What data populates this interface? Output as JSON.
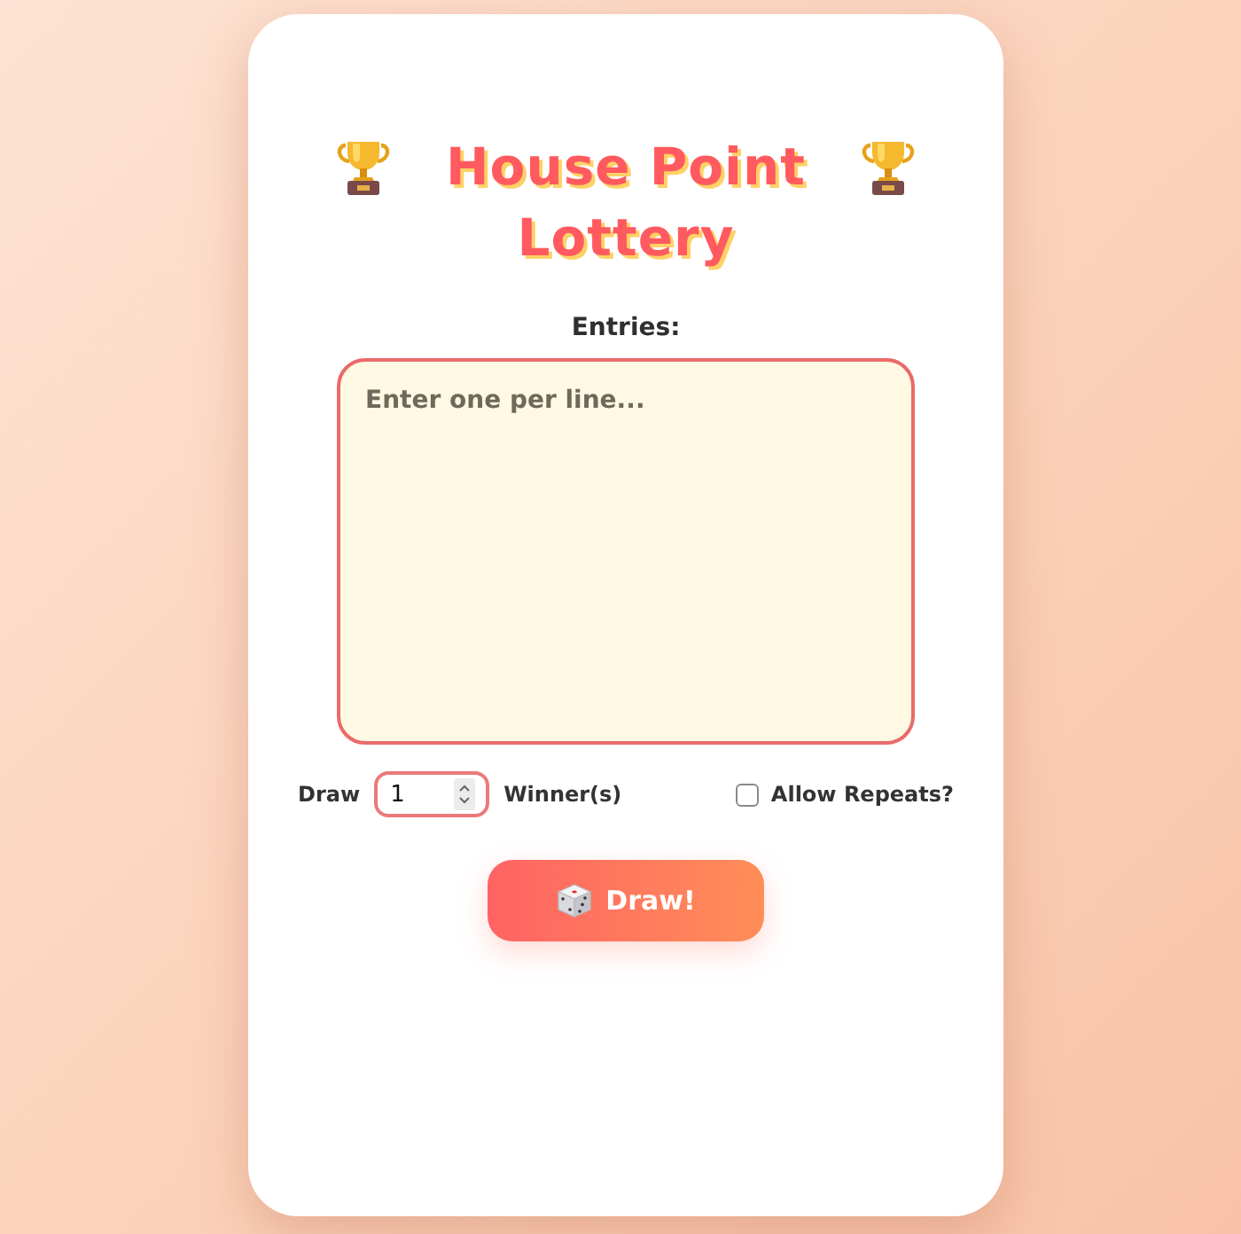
{
  "title": {
    "text": "House Point Lottery"
  },
  "entries": {
    "label": "Entries:",
    "placeholder": "Enter one per line..."
  },
  "options": {
    "draw_label": "Draw",
    "count": "1",
    "winners_label": "Winner(s)",
    "allow_repeats": {
      "label": "Allow Repeats?",
      "checked": false
    }
  },
  "button": {
    "label": "Draw!"
  }
}
